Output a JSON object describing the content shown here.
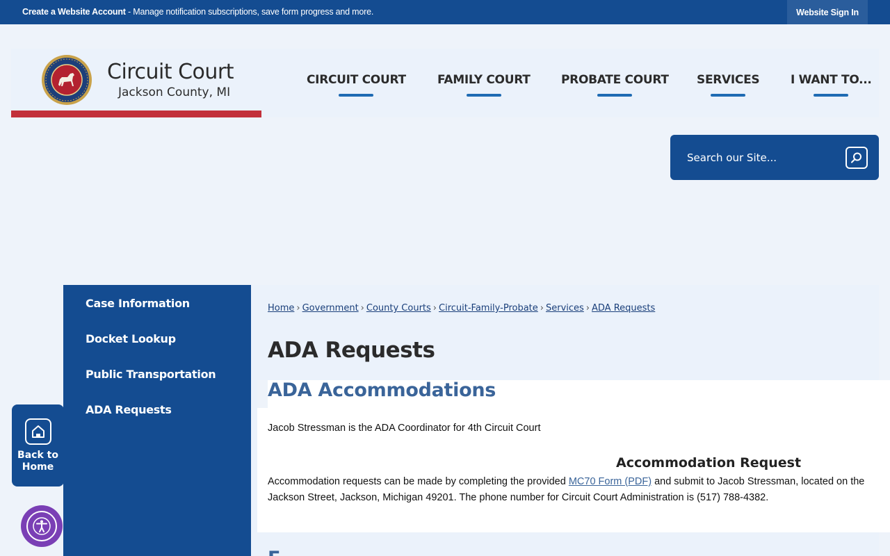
{
  "topbar": {
    "create_account": "Create a Website Account",
    "message": " - Manage notification subscriptions, save form progress and more.",
    "sign_in": "Website Sign In"
  },
  "logo": {
    "title": "Circuit Court",
    "subtitle": "Jackson County, MI"
  },
  "nav": {
    "items": [
      "CIRCUIT COURT",
      "FAMILY COURT",
      "PROBATE COURT",
      "SERVICES",
      "I WANT TO..."
    ]
  },
  "search": {
    "placeholder": "Search our Site..."
  },
  "sidebar": {
    "items": [
      "Case Information",
      "Docket Lookup",
      "Public Transportation",
      "ADA Requests"
    ]
  },
  "back_home": {
    "line1": "Back to",
    "line2": "Home"
  },
  "breadcrumb": [
    "Home",
    "Government",
    "County Courts",
    "Circuit-Family-Probate",
    "Services",
    "ADA Requests"
  ],
  "page": {
    "title": "ADA Requests",
    "section_heading": "ADA Accommodations",
    "coordinator_text": "Jacob Stressman is the ADA Coordinator for 4th Circuit Court",
    "request_heading": "Accommodation Request",
    "request_text_before": "Accommodation requests can be made by completing the provided ",
    "request_link": "MC70 Form (PDF)",
    "request_text_after": " and submit to Jacob Stressman, located on the",
    "request_text_line2": "Jackson Street, Jackson, Michigan 49201.  The phone number for Circuit Court Administration is (517) 788-4382.",
    "next_heading_partial": "F"
  },
  "colors": {
    "brand_blue": "#144c91",
    "accent_red": "#c2303a",
    "heading_blue": "#3a6499",
    "a11y_purple": "#7a3fb5"
  }
}
